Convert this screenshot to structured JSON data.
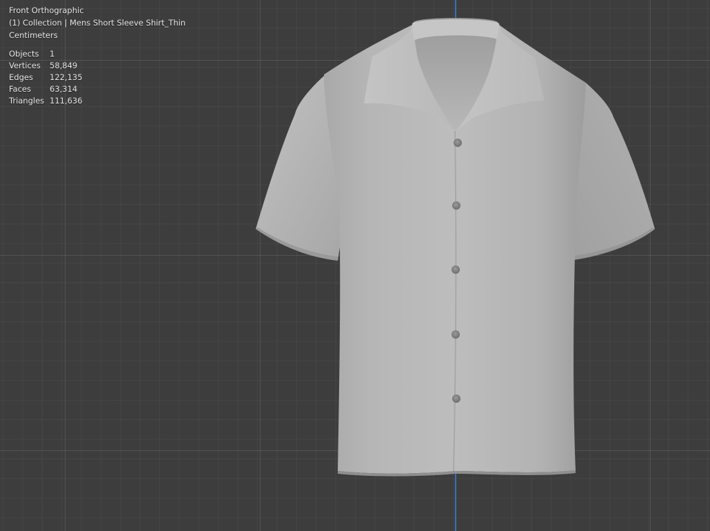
{
  "viewport": {
    "view_name": "Front Orthographic",
    "collection_line": "(1) Collection | Mens Short Sleeve Shirt_Thin",
    "units": "Centimeters",
    "stats": [
      {
        "label": "Objects",
        "value": "1"
      },
      {
        "label": "Vertices",
        "value": "58,849"
      },
      {
        "label": "Edges",
        "value": "122,135"
      },
      {
        "label": "Faces",
        "value": "63,314"
      },
      {
        "label": "Triangles",
        "value": "111,636"
      }
    ]
  },
  "colors": {
    "background": "#3d3d3d",
    "z_axis": "#3c6fb0",
    "overlay_text": "#e6e6e6",
    "shirt": "#b4b4b4"
  }
}
